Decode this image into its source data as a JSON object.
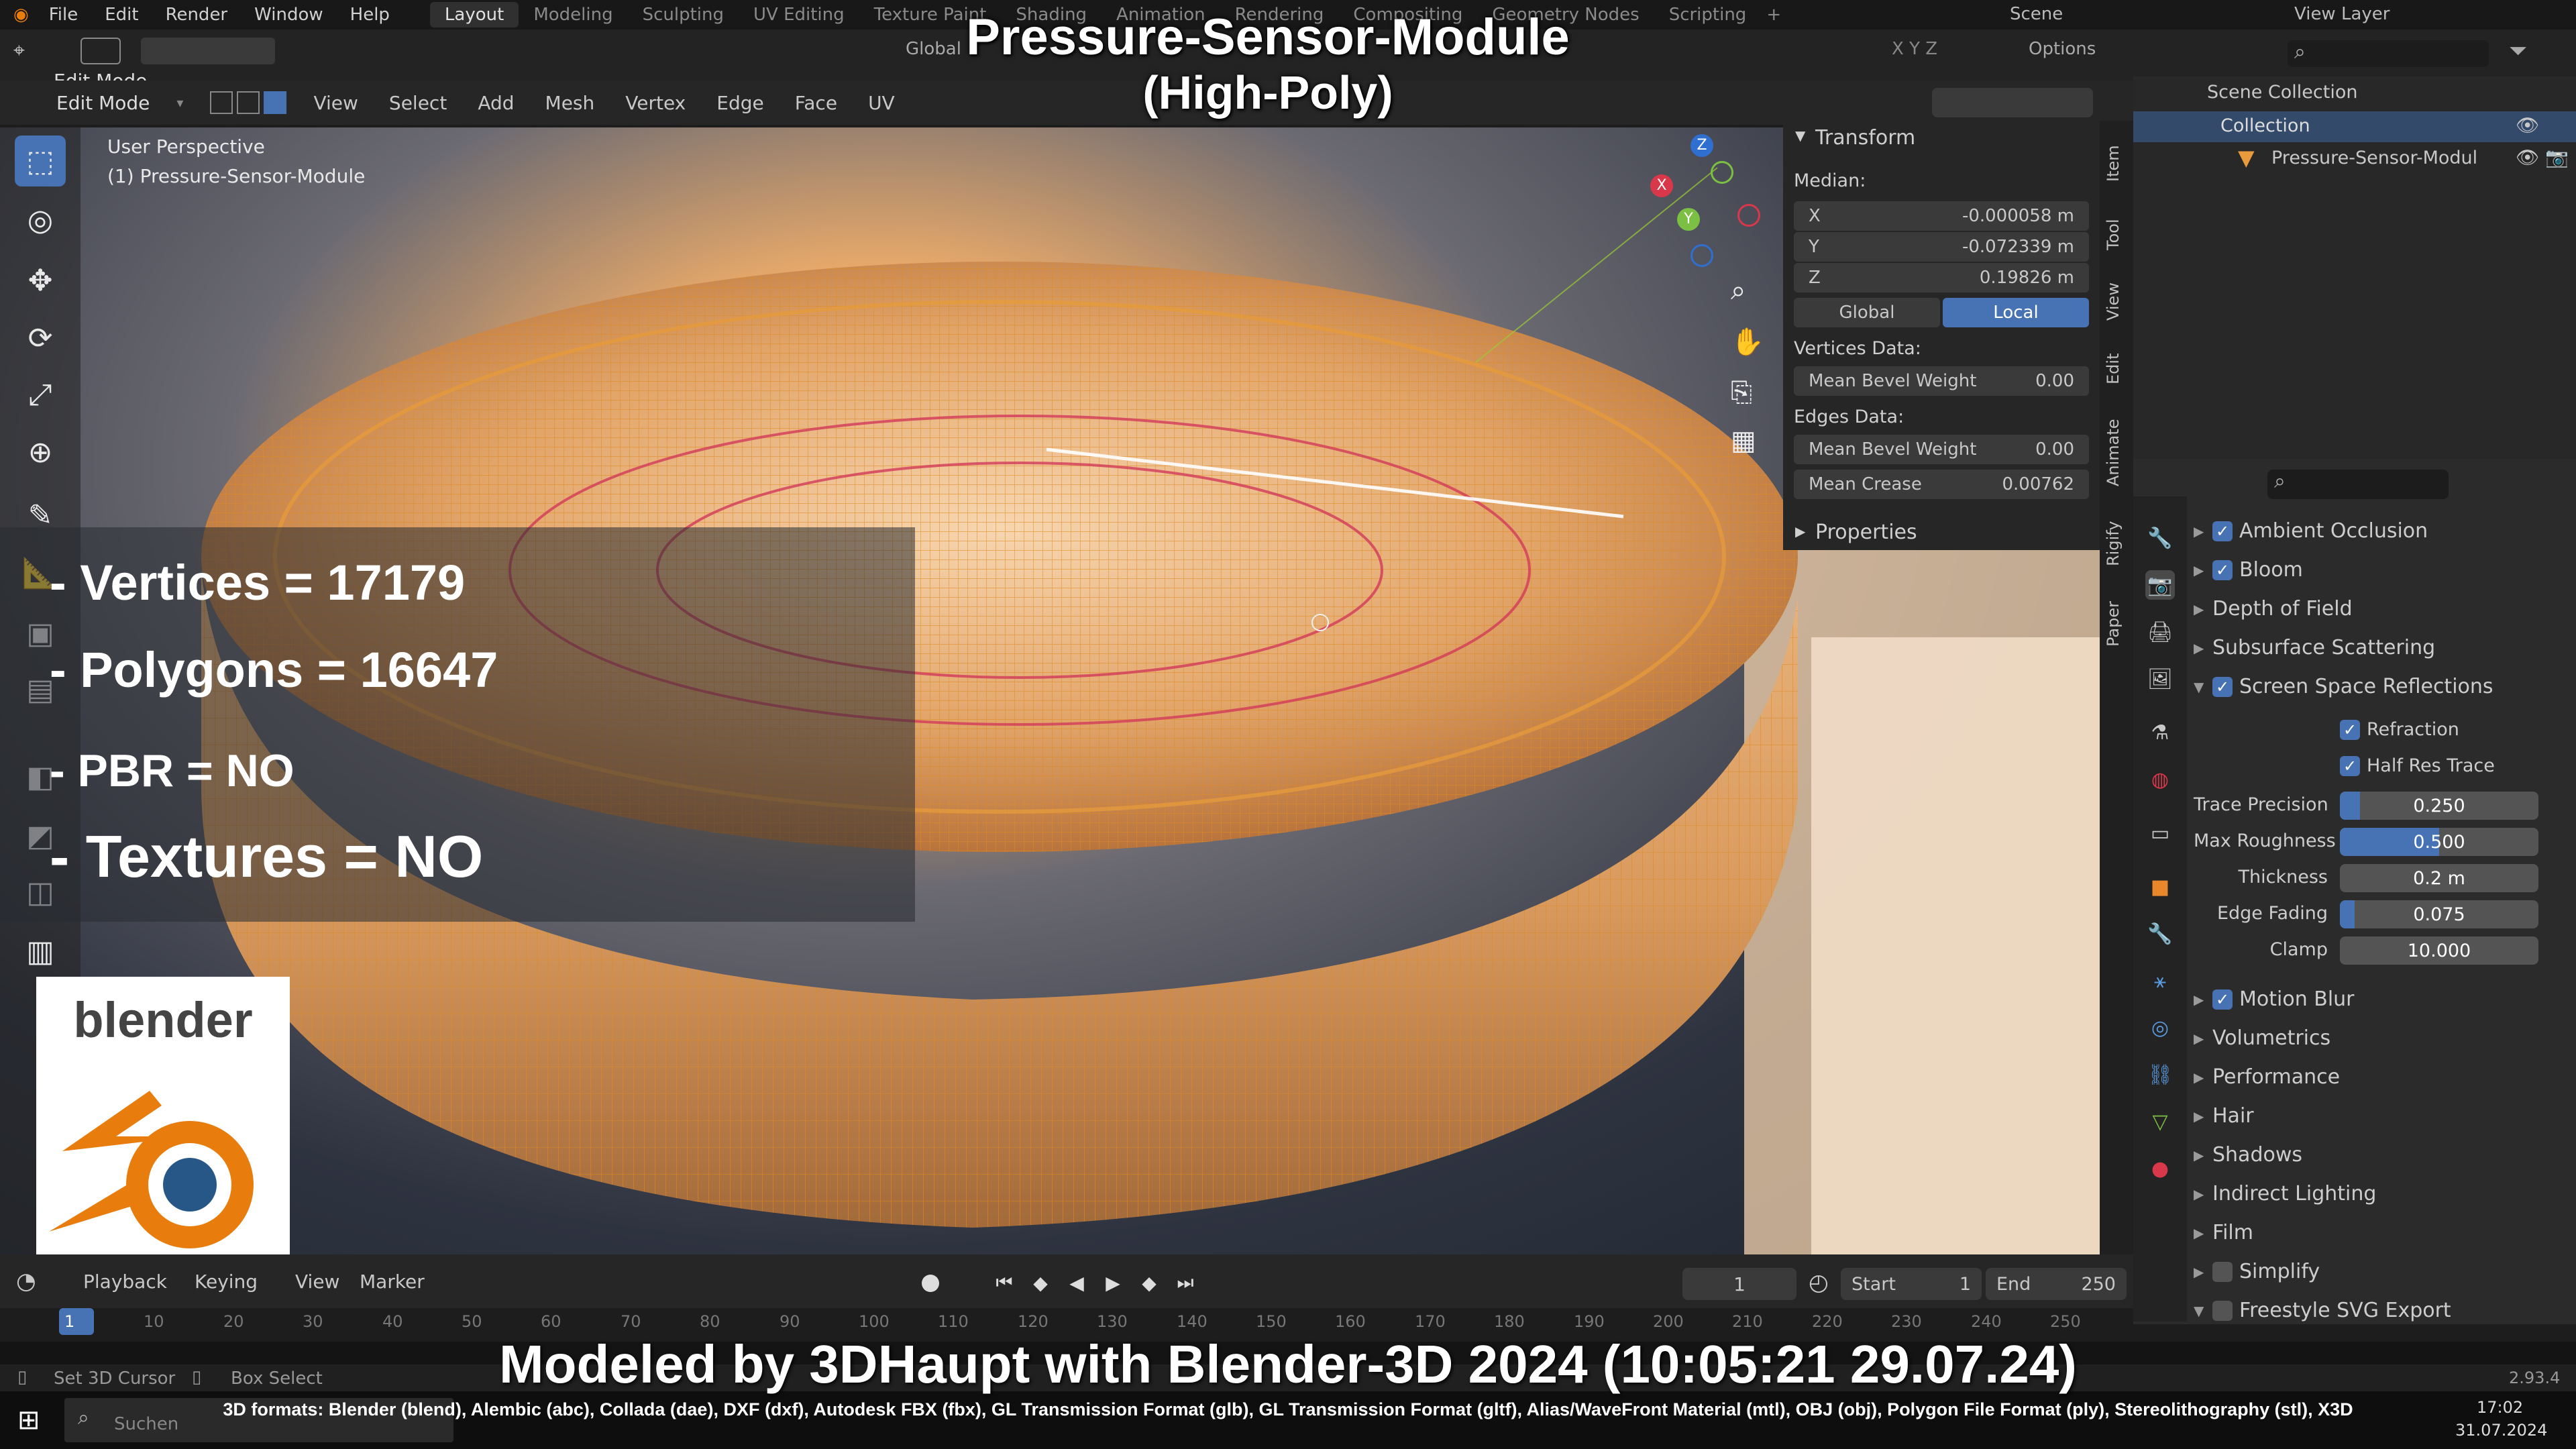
{
  "overlay_title": {
    "line1": "Pressure-Sensor-Module",
    "line2": "(High-Poly)"
  },
  "menu": {
    "items": [
      "File",
      "Edit",
      "Render",
      "Window",
      "Help"
    ]
  },
  "workspaces": [
    "Layout",
    "Modeling",
    "Sculpting",
    "UV Editing",
    "Texture Paint",
    "Shading",
    "Animation",
    "Rendering",
    "Compositing",
    "Geometry Nodes",
    "Scripting"
  ],
  "topright": {
    "scene": "Scene",
    "view_layer": "View Layer"
  },
  "header": {
    "mode": "Edit Mode",
    "view": "View",
    "select": "Select",
    "add": "Add",
    "mesh": "Mesh",
    "vertex": "Vertex",
    "edge": "Edge",
    "face": "Face",
    "uv": "UV",
    "orientation": "Global",
    "options": "Options",
    "axes": "X  Y  Z"
  },
  "viewport": {
    "perspective": "User Perspective",
    "object": "(1) Pressure-Sensor-Module"
  },
  "npanel": {
    "transform_title": "Transform",
    "median_label": "Median:",
    "x": {
      "label": "X",
      "value": "-0.000058 m"
    },
    "y": {
      "label": "Y",
      "value": "-0.072339 m"
    },
    "z": {
      "label": "Z",
      "value": "0.19826 m"
    },
    "global": "Global",
    "local": "Local",
    "vertices_data": "Vertices Data:",
    "vert_bevel": {
      "label": "Mean Bevel Weight",
      "value": "0.00"
    },
    "edges_data": "Edges Data:",
    "edge_bevel": {
      "label": "Mean Bevel Weight",
      "value": "0.00"
    },
    "crease": {
      "label": "Mean Crease",
      "value": "0.00762"
    },
    "properties": "Properties"
  },
  "vtabs": [
    "Item",
    "Tool",
    "View",
    "Edit",
    "Animate",
    "Rigify",
    "Paper"
  ],
  "outliner": {
    "scene_collection": "Scene Collection",
    "collection": "Collection",
    "object": "Pressure-Sensor-Modul"
  },
  "render_props": {
    "ao": "Ambient Occlusion",
    "bloom": "Bloom",
    "dof": "Depth of Field",
    "sss": "Subsurface Scattering",
    "ssr": "Screen Space Reflections",
    "refraction": "Refraction",
    "half_res": "Half Res Trace",
    "trace_precision": {
      "label": "Trace Precision",
      "value": "0.250",
      "fill": 0.1
    },
    "max_roughness": {
      "label": "Max Roughness",
      "value": "0.500",
      "fill": 0.5
    },
    "thickness": {
      "label": "Thickness",
      "value": "0.2 m",
      "fill": 0.0
    },
    "edge_fading": {
      "label": "Edge Fading",
      "value": "0.075",
      "fill": 0.075
    },
    "clamp": {
      "label": "Clamp",
      "value": "10.000",
      "fill": 0.0
    },
    "motion_blur": "Motion Blur",
    "volumetrics": "Volumetrics",
    "performance": "Performance",
    "hair": "Hair",
    "shadows": "Shadows",
    "indirect": "Indirect Lighting",
    "film": "Film",
    "simplify": "Simplify",
    "freestyle_svg": "Freestyle SVG Export"
  },
  "stats": {
    "vertices": "- Vertices = 17179",
    "polygons": "- Polygons = 16647",
    "pbr": "- PBR =  NO",
    "textures": "- Textures = NO"
  },
  "logo_text": "blender",
  "timeline": {
    "playback": "Playback",
    "keying": "Keying",
    "view": "View",
    "marker": "Marker",
    "current_frame": "1",
    "start_label": "Start",
    "start": "1",
    "end_label": "End",
    "end": "250",
    "ticks": [
      "1",
      "10",
      "20",
      "30",
      "40",
      "50",
      "60",
      "70",
      "80",
      "90",
      "100",
      "110",
      "120",
      "130",
      "140",
      "150",
      "160",
      "170",
      "180",
      "190",
      "200",
      "210",
      "220",
      "230",
      "240",
      "250"
    ]
  },
  "status": {
    "set_cursor": "Set 3D Cursor",
    "box_select": "Box Select",
    "version": "2.93.4"
  },
  "taskbar": {
    "search": "Suchen",
    "time": "17:02",
    "date": "31.07.2024"
  },
  "credit": "Modeled by 3DHaupt with Blender-3D 2024 (10:05:21  29.07.24)",
  "formats": "3D formats: Blender (blend), Alembic (abc), Collada (dae), DXF (dxf), Autodesk FBX (fbx), GL Transmission Format (glb), GL Transmission Format (gltf), Alias/WaveFront Material (mtl), OBJ (obj), Polygon File Format (ply), Stereolithography (stl), X3D",
  "colors": {
    "accent": "#4772b3",
    "mesh": "#e89a3c",
    "brand_orange": "#e87d0d",
    "brand_blue": "#265787"
  }
}
